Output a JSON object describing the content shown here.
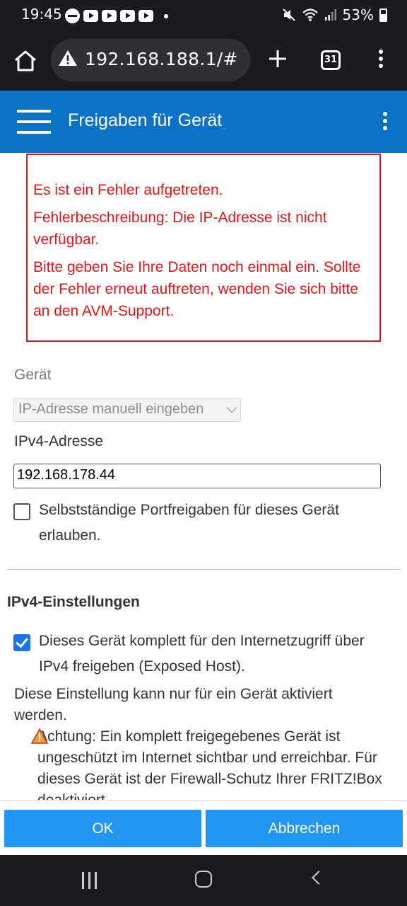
{
  "status_bar": {
    "time": "19:45",
    "battery": "53%",
    "icons": [
      "notification-icon",
      "youtube-icon",
      "youtube-icon",
      "youtube-icon",
      "youtube-icon",
      "mute-icon",
      "wifi-icon",
      "signal-icon",
      "battery-icon"
    ]
  },
  "browser": {
    "url": "192.168.188.1/#",
    "tab_count": "31"
  },
  "header": {
    "title": "Freigaben für Gerät"
  },
  "error": {
    "line1": "Es ist ein Fehler aufgetreten.",
    "line2": "Fehlerbeschreibung: Die IP-Adresse ist nicht verfügbar.",
    "line3": "Bitte geben Sie Ihre Daten noch einmal ein. Sollte der Fehler erneut auftreten, wenden Sie sich bitte an den AVM-Support."
  },
  "form": {
    "device_label": "Gerät",
    "device_select": "IP-Adresse manuell eingeben",
    "ipv4_label": "IPv4-Adresse",
    "ipv4_value": "192.168.178.44",
    "port_checkbox_label": "Selbstständige Portfreigaben für dieses Gerät erlauben.",
    "port_checkbox_checked": false
  },
  "ipv4_settings": {
    "title": "IPv4-Einstellungen",
    "exposed_host_label": "Dieses Gerät komplett für den Internetzugriff über IPv4 freigeben (Exposed Host).",
    "exposed_host_checked": true,
    "info": "Diese Einstellung kann nur für ein Gerät aktiviert werden.",
    "warning": "Achtung: Ein komplett freigegebenes Gerät ist ungeschützt im Internet sichtbar und erreichbar. Für dieses Gerät ist der Firewall-Schutz Ihrer FRITZ!Box deaktiviert."
  },
  "actions": {
    "ok": "OK",
    "cancel": "Abbrechen"
  },
  "colors": {
    "header_blue": "#0b72c5",
    "button_blue": "#2196f3",
    "error_red": "#e4161a",
    "checkbox_blue": "#1a73e8"
  }
}
